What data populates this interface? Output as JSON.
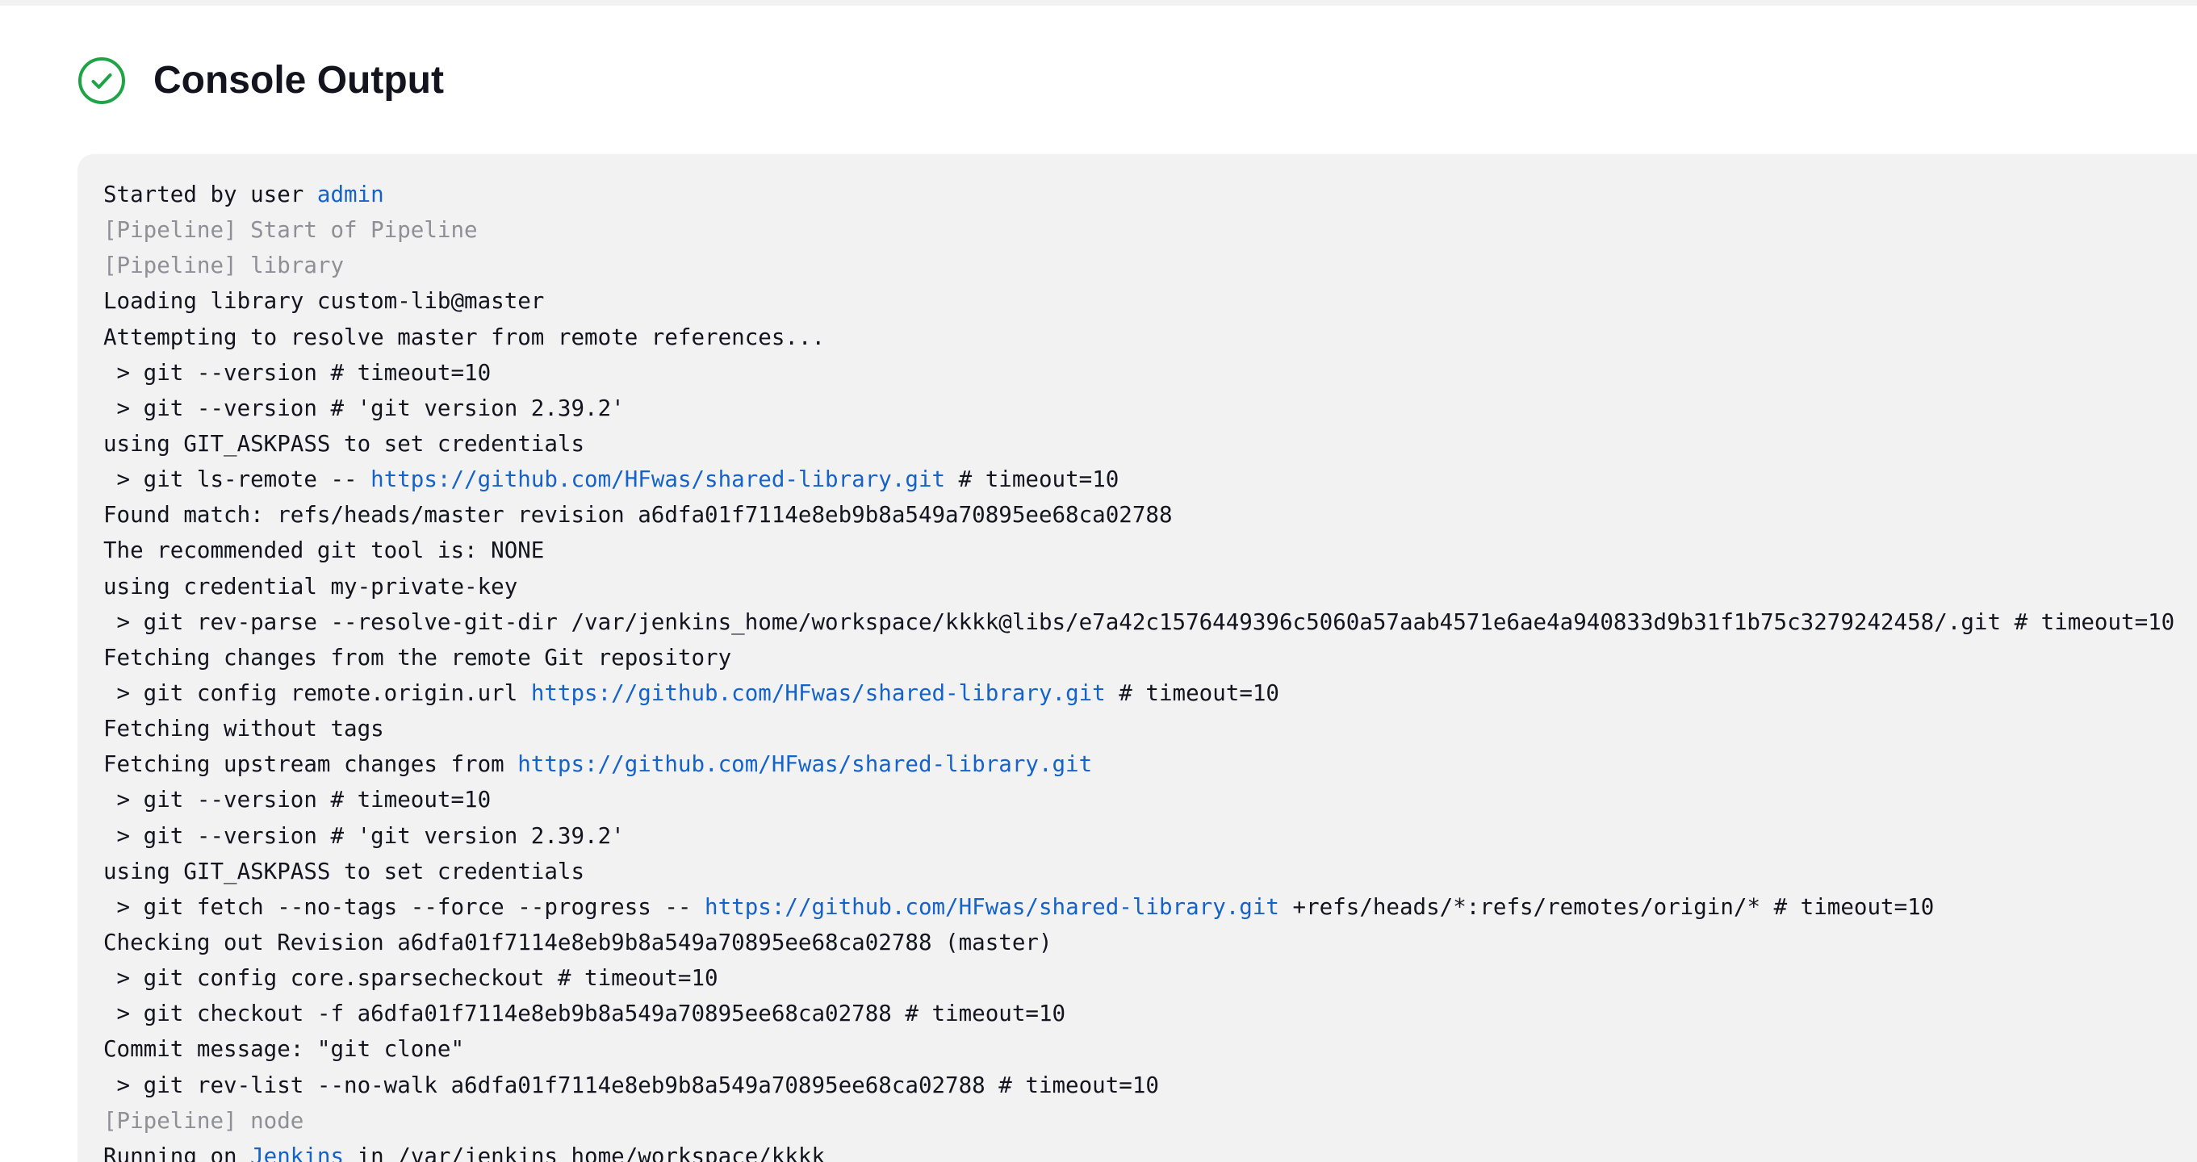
{
  "header": {
    "title": "Console Output",
    "status_icon": "success-check-circle-icon",
    "status_color": "#1ea446"
  },
  "colors": {
    "link": "#1563c8",
    "pipeline_step": "#8f8f96",
    "text": "#14141f",
    "console_background": "#f2f2f3"
  },
  "console": {
    "lines": [
      {
        "kind": "text",
        "segments": [
          {
            "text": "Started by user "
          },
          {
            "text": "admin",
            "link": true
          }
        ]
      },
      {
        "kind": "pipeline",
        "segments": [
          {
            "text": "[Pipeline] Start of Pipeline"
          }
        ]
      },
      {
        "kind": "pipeline",
        "segments": [
          {
            "text": "[Pipeline] library"
          }
        ]
      },
      {
        "kind": "text",
        "segments": [
          {
            "text": "Loading library custom-lib@master"
          }
        ]
      },
      {
        "kind": "text",
        "segments": [
          {
            "text": "Attempting to resolve master from remote references..."
          }
        ]
      },
      {
        "kind": "text",
        "segments": [
          {
            "text": " > git --version # timeout=10"
          }
        ]
      },
      {
        "kind": "text",
        "segments": [
          {
            "text": " > git --version # 'git version 2.39.2'"
          }
        ]
      },
      {
        "kind": "text",
        "segments": [
          {
            "text": "using GIT_ASKPASS to set credentials"
          }
        ]
      },
      {
        "kind": "text",
        "segments": [
          {
            "text": " > git ls-remote -- "
          },
          {
            "text": "https://github.com/HFwas/shared-library.git",
            "link": true
          },
          {
            "text": " # timeout=10"
          }
        ]
      },
      {
        "kind": "text",
        "segments": [
          {
            "text": "Found match: refs/heads/master revision a6dfa01f7114e8eb9b8a549a70895ee68ca02788"
          }
        ]
      },
      {
        "kind": "text",
        "segments": [
          {
            "text": "The recommended git tool is: NONE"
          }
        ]
      },
      {
        "kind": "text",
        "segments": [
          {
            "text": "using credential my-private-key"
          }
        ]
      },
      {
        "kind": "text",
        "segments": [
          {
            "text": " > git rev-parse --resolve-git-dir /var/jenkins_home/workspace/kkkk@libs/e7a42c1576449396c5060a57aab4571e6ae4a940833d9b31f1b75c3279242458/.git # timeout=10"
          }
        ]
      },
      {
        "kind": "text",
        "segments": [
          {
            "text": "Fetching changes from the remote Git repository"
          }
        ]
      },
      {
        "kind": "text",
        "segments": [
          {
            "text": " > git config remote.origin.url "
          },
          {
            "text": "https://github.com/HFwas/shared-library.git",
            "link": true
          },
          {
            "text": " # timeout=10"
          }
        ]
      },
      {
        "kind": "text",
        "segments": [
          {
            "text": "Fetching without tags"
          }
        ]
      },
      {
        "kind": "text",
        "segments": [
          {
            "text": "Fetching upstream changes from "
          },
          {
            "text": "https://github.com/HFwas/shared-library.git",
            "link": true
          }
        ]
      },
      {
        "kind": "text",
        "segments": [
          {
            "text": " > git --version # timeout=10"
          }
        ]
      },
      {
        "kind": "text",
        "segments": [
          {
            "text": " > git --version # 'git version 2.39.2'"
          }
        ]
      },
      {
        "kind": "text",
        "segments": [
          {
            "text": "using GIT_ASKPASS to set credentials"
          }
        ]
      },
      {
        "kind": "text",
        "segments": [
          {
            "text": " > git fetch --no-tags --force --progress -- "
          },
          {
            "text": "https://github.com/HFwas/shared-library.git",
            "link": true
          },
          {
            "text": " +refs/heads/*:refs/remotes/origin/* # timeout=10"
          }
        ]
      },
      {
        "kind": "text",
        "segments": [
          {
            "text": "Checking out Revision a6dfa01f7114e8eb9b8a549a70895ee68ca02788 (master)"
          }
        ]
      },
      {
        "kind": "text",
        "segments": [
          {
            "text": " > git config core.sparsecheckout # timeout=10"
          }
        ]
      },
      {
        "kind": "text",
        "segments": [
          {
            "text": " > git checkout -f a6dfa01f7114e8eb9b8a549a70895ee68ca02788 # timeout=10"
          }
        ]
      },
      {
        "kind": "text",
        "segments": [
          {
            "text": "Commit message: \"git clone\""
          }
        ]
      },
      {
        "kind": "text",
        "segments": [
          {
            "text": " > git rev-list --no-walk a6dfa01f7114e8eb9b8a549a70895ee68ca02788 # timeout=10"
          }
        ]
      },
      {
        "kind": "pipeline",
        "segments": [
          {
            "text": "[Pipeline] node"
          }
        ]
      },
      {
        "kind": "text",
        "segments": [
          {
            "text": "Running on "
          },
          {
            "text": "Jenkins",
            "link": true
          },
          {
            "text": " in /var/jenkins_home/workspace/kkkk"
          }
        ]
      }
    ]
  }
}
